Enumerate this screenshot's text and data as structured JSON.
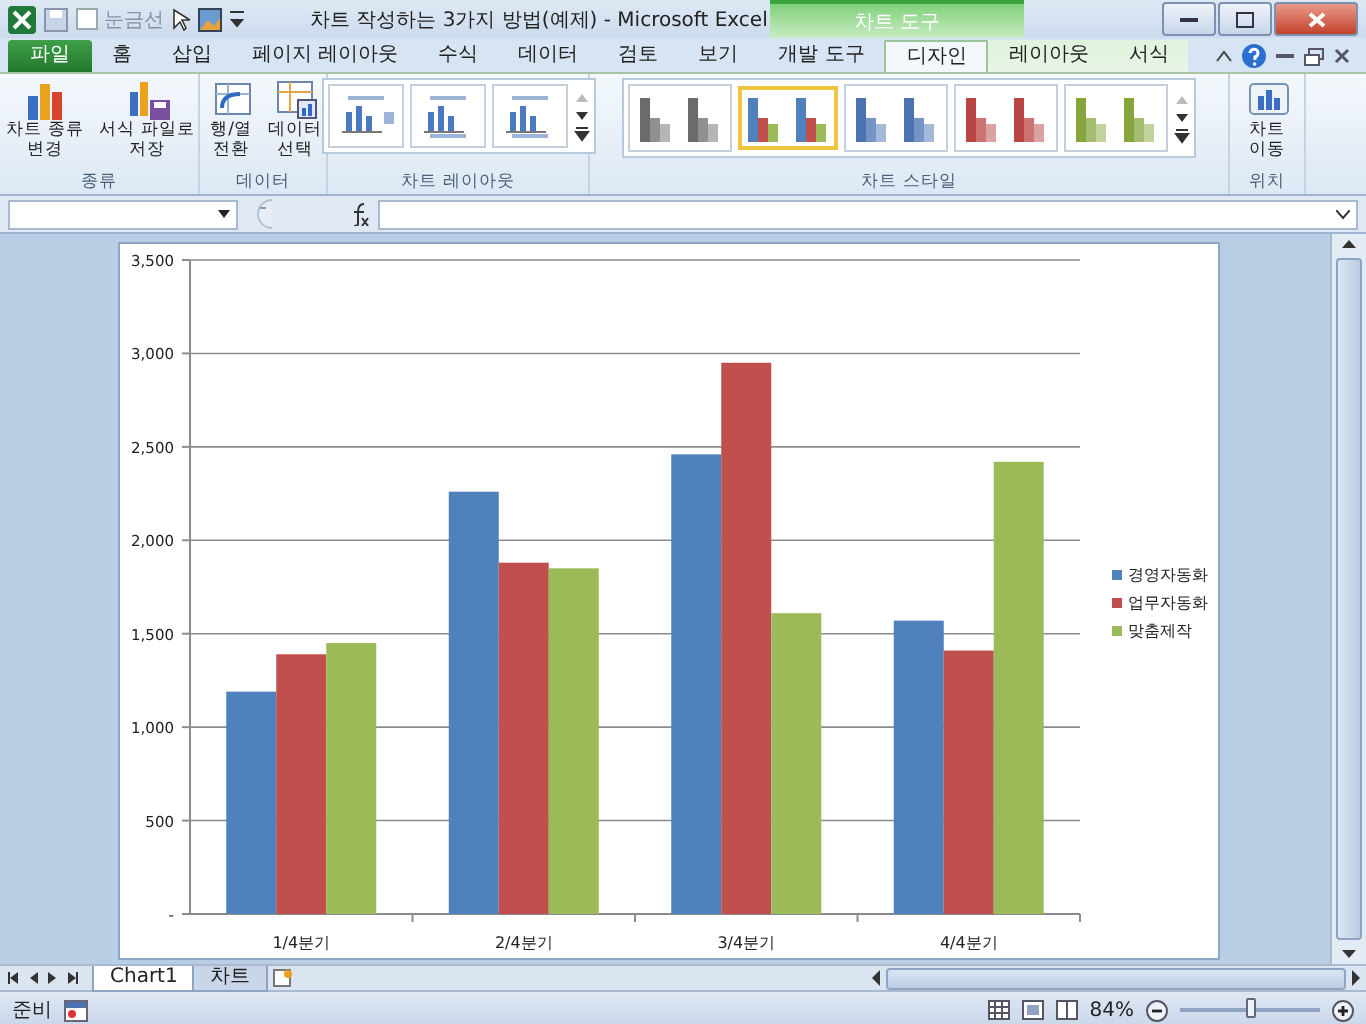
{
  "window": {
    "title": "차트 작성하는 3가지 방법(예제) - Microsoft Excel",
    "contextual_group": "차트 도구"
  },
  "gridlines_toggle": {
    "label": "눈금선",
    "checked": false,
    "disabled": true
  },
  "tabs": [
    {
      "label": "파일",
      "kind": "file",
      "selected": false
    },
    {
      "label": "홈",
      "kind": "normal",
      "selected": false
    },
    {
      "label": "삽입",
      "kind": "normal",
      "selected": false
    },
    {
      "label": "페이지 레이아웃",
      "kind": "normal",
      "selected": false
    },
    {
      "label": "수식",
      "kind": "normal",
      "selected": false
    },
    {
      "label": "데이터",
      "kind": "normal",
      "selected": false
    },
    {
      "label": "검토",
      "kind": "normal",
      "selected": false
    },
    {
      "label": "보기",
      "kind": "normal",
      "selected": false
    },
    {
      "label": "개발 도구",
      "kind": "normal",
      "selected": false
    },
    {
      "label": "디자인",
      "kind": "contextual",
      "selected": true
    },
    {
      "label": "레이아웃",
      "kind": "contextual",
      "selected": false
    },
    {
      "label": "서식",
      "kind": "contextual",
      "selected": false
    }
  ],
  "ribbon_groups": [
    {
      "label": "종류",
      "kind": "buttons",
      "buttons": [
        {
          "label": "차트 종류 변경",
          "kind": "chart-type"
        },
        {
          "label": "서식 파일로 저장",
          "kind": "template"
        }
      ]
    },
    {
      "label": "데이터",
      "kind": "buttons",
      "buttons": [
        {
          "label": "행/열 전환",
          "kind": "switch"
        },
        {
          "label": "데이터 선택",
          "kind": "select-data"
        }
      ]
    },
    {
      "label": "차트 레이아웃",
      "kind": "layouts",
      "layouts": [
        {
          "kind": "legend-right"
        },
        {
          "kind": "axis-titles"
        },
        {
          "kind": "axis-titles"
        }
      ]
    },
    {
      "label": "차트 스타일",
      "kind": "styles",
      "styles": [
        {
          "kind": "mono",
          "color": "#6b6b6b",
          "selected": false
        },
        {
          "kind": "multi",
          "selected": true
        },
        {
          "kind": "mono",
          "color": "#4a72b0",
          "selected": false
        },
        {
          "kind": "mono",
          "color": "#b94444",
          "selected": false
        },
        {
          "kind": "mono",
          "color": "#86a53c",
          "selected": false
        }
      ]
    },
    {
      "label": "위치",
      "kind": "buttons",
      "buttons": [
        {
          "label": "차트 이동",
          "kind": "move"
        }
      ]
    }
  ],
  "chart": {
    "chart_data": {
      "type": "bar",
      "categories": [
        "1/4분기",
        "2/4분기",
        "3/4분기",
        "4/4분기"
      ],
      "series": [
        {
          "name": "경영자동화",
          "color": "#4f81bd",
          "values": [
            1190,
            2260,
            2460,
            1570
          ]
        },
        {
          "name": "업무자동화",
          "color": "#c0504d",
          "values": [
            1390,
            1880,
            2950,
            1410
          ]
        },
        {
          "name": "맞춤제작",
          "color": "#9bbb59",
          "values": [
            1450,
            1850,
            1610,
            2420
          ]
        }
      ],
      "ylim": [
        0,
        3500
      ],
      "grid": true,
      "legend": true,
      "yticks": [
        {
          "value": 0,
          "label": "-"
        },
        {
          "value": 500,
          "label": "500"
        },
        {
          "value": 1000,
          "label": "1,000"
        },
        {
          "value": 1500,
          "label": "1,500"
        },
        {
          "value": 2000,
          "label": "2,000"
        },
        {
          "value": 2500,
          "label": "2,500"
        },
        {
          "value": 3000,
          "label": "3,000"
        },
        {
          "value": 3500,
          "label": "3,500"
        }
      ]
    }
  },
  "sheet_tabs": [
    {
      "label": "Chart1",
      "selected": true
    },
    {
      "label": "차트",
      "selected": false
    }
  ],
  "status_bar": {
    "status": "준비",
    "zoom": "84%",
    "zoom_slider": {
      "level": 0.5
    }
  }
}
